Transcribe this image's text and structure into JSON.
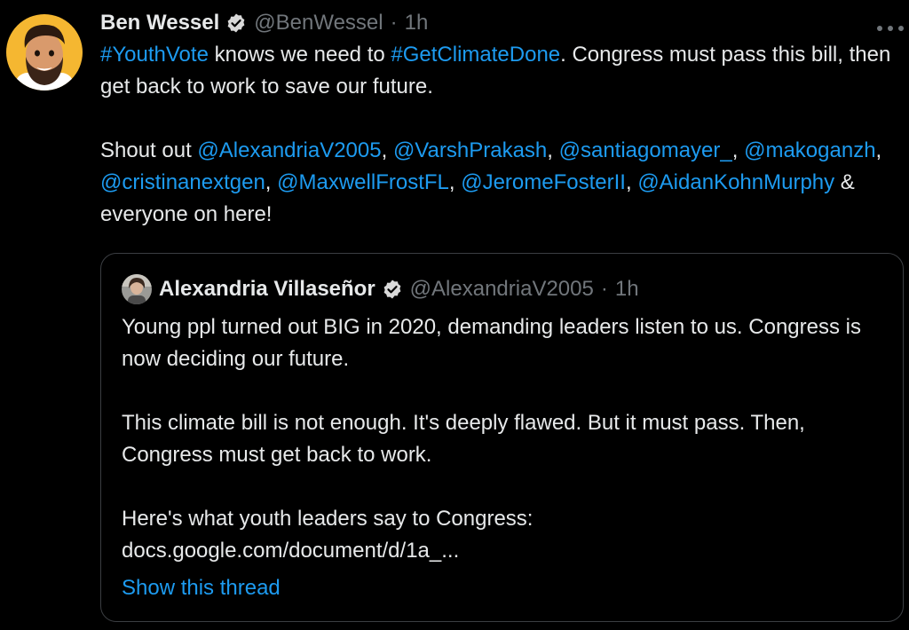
{
  "tweet": {
    "author_name": "Ben Wessel",
    "handle": "@BenWessel",
    "separator": "·",
    "time": "1h",
    "more_icon": "ellipsis-icon",
    "verified_icon": "verified-badge-icon",
    "avatar_icon": "avatar-cartoon",
    "text": {
      "hashtag_youthvote": "#YouthVote",
      "t1": " knows we need to ",
      "hashtag_getclimatedone": "#GetClimateDone",
      "t2": ". Congress must pass this bill, then get back to work to save our future.",
      "shoutout": "Shout out ",
      "mention_1": "@AlexandriaV2005",
      "mention_2": "@VarshPrakash",
      "mention_3": "@santiagomayer_",
      "mention_4": "@makoganzh",
      "mention_5": "@cristinanextgen",
      "mention_6": "@MaxwellFrostFL",
      "mention_7": "@JeromeFosterII",
      "mention_8": "@AidanKohnMurphy",
      "comma": ", ",
      "closing": " & everyone on here!"
    }
  },
  "quote": {
    "author_name": "Alexandria Villaseñor",
    "handle": "@AlexandriaV2005",
    "separator": "·",
    "time": "1h",
    "p1": "Young ppl turned out BIG in 2020, demanding leaders listen to us. Congress is now deciding our future.",
    "p2": "This climate bill is not enough. It's deeply flawed. But it must pass. Then, Congress must get back to work.",
    "p3_label": "Here's what youth leaders say to Congress:",
    "p3_link": "docs.google.com/document/d/1a_...",
    "show_thread": "Show this thread"
  },
  "colors": {
    "background": "#000000",
    "text": "#e7e9ea",
    "muted": "#71767b",
    "link": "#1d9bf0",
    "border": "#3b3e42"
  }
}
